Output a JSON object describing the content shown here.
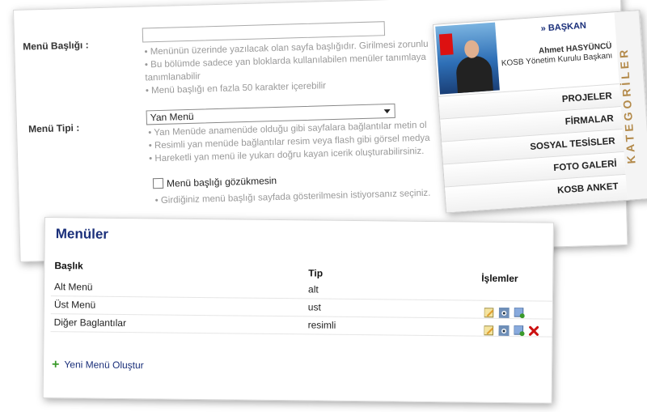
{
  "form": {
    "title_label": "Menü Başlığı :",
    "title_value": "",
    "title_hints": [
      "• Menünün üzerinde yazılacak olan sayfa başlığıdır. Girilmesi zorunlu",
      "• Bu bölümde sadece yan bloklarda kullanılabilen menüler tanımlaya",
      "tanımlanabilir",
      "• Menü başlığı en fazla 50 karakter içerebilir"
    ],
    "type_label": "Menü Tipi :",
    "type_selected": "Yan Menü",
    "type_hints": [
      "• Yan Menüde anamenüde olduğu gibi sayfalara bağlantılar metin ol",
      "• Resimli yan menüde bağlantılar resim veya flash gibi görsel medya",
      "• Hareketli yan menü ile yukarı doğru kayan icerik oluşturabilirsiniz."
    ],
    "checkbox_label": "Menü başlığı gözükmesin",
    "checkbox_hint": "• Girdiğiniz menü başlığı sayfada gösterilmesin istiyorsanız seçiniz."
  },
  "sidebar": {
    "baskan_label": "BAŞKAN",
    "person_name": "Ahmet HASYÜNCÜ",
    "person_title": "KOSB Yönetim Kurulu Başkanı",
    "items": [
      {
        "label": "PROJELER"
      },
      {
        "label": "FİRMALAR"
      },
      {
        "label": "SOSYAL TESİSLER"
      },
      {
        "label": "FOTO GALERİ"
      },
      {
        "label": "KOSB ANKET"
      }
    ],
    "vertical_label": "KATEGORİLER"
  },
  "menus": {
    "title": "Menüler",
    "columns": {
      "baslik": "Başlık",
      "tip": "Tip",
      "islemler": "İşlemler"
    },
    "rows": [
      {
        "name": "Alt Menü",
        "tip": "alt"
      },
      {
        "name": "Üst Menü",
        "tip": "ust"
      },
      {
        "name": "Diğer Baglantılar",
        "tip": "resimli"
      }
    ],
    "create_label": "Yeni Menü Oluştur"
  },
  "colors": {
    "accent": "#1a2f7a",
    "gold": "#b38a4a",
    "delete": "#cc1111",
    "add": "#3a9a2a"
  }
}
